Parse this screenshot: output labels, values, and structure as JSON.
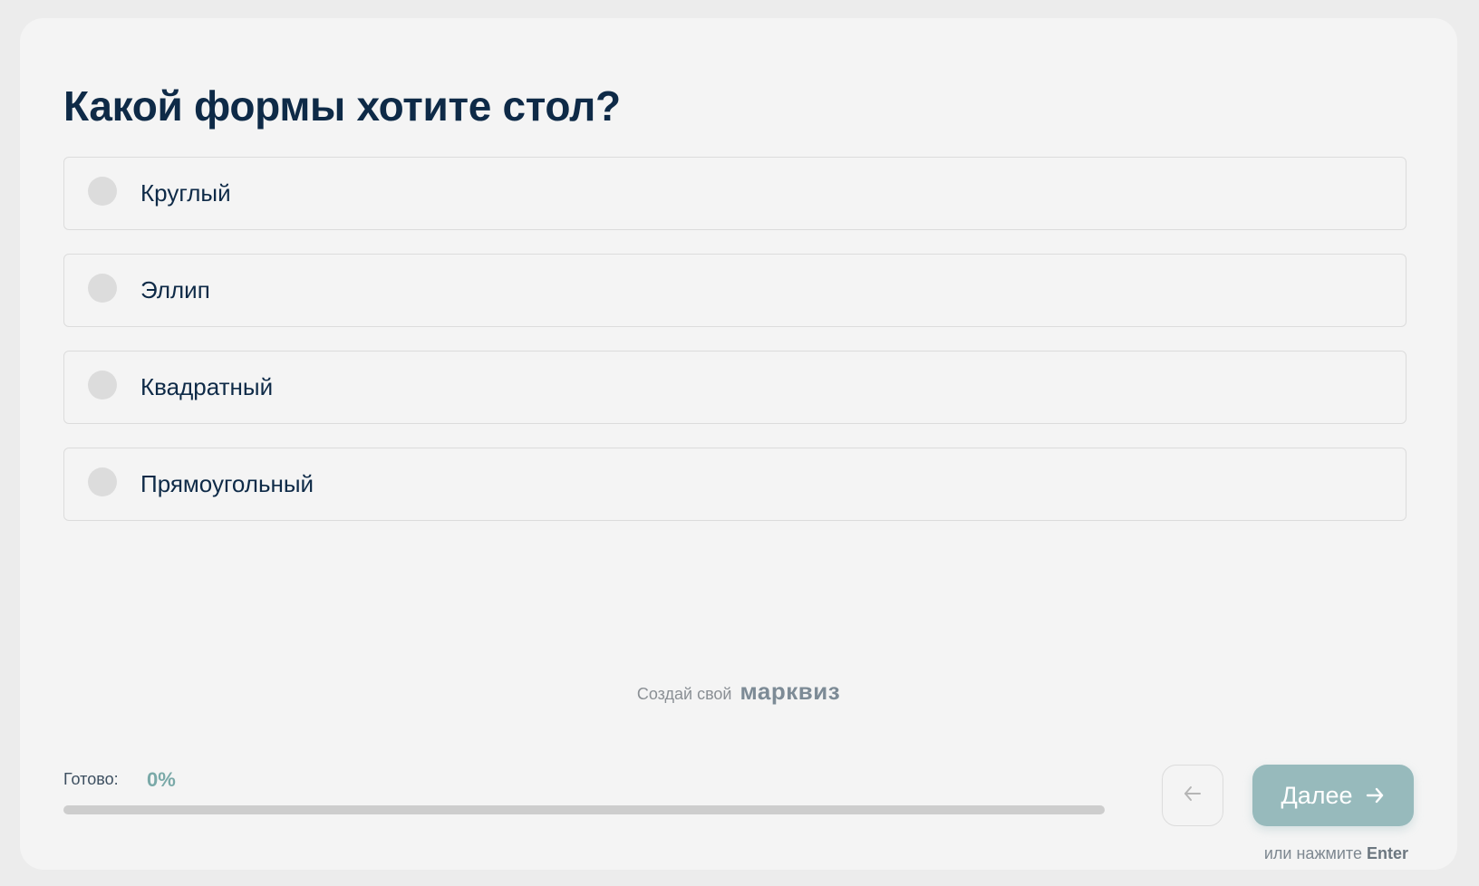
{
  "question": {
    "title": "Какой формы хотите стол?"
  },
  "options": [
    {
      "label": "Круглый"
    },
    {
      "label": "Эллип"
    },
    {
      "label": "Квадратный"
    },
    {
      "label": "Прямоугольный"
    }
  ],
  "promo": {
    "text": "Создай свой",
    "brand": "марквиз"
  },
  "progress": {
    "label": "Готово:",
    "value_text": "0%",
    "value": 0
  },
  "nav": {
    "back_icon": "arrow-left-icon",
    "next_label": "Далее",
    "next_icon": "arrow-right-icon",
    "hint_text": "или нажмите",
    "hint_key": "Enter"
  },
  "colors": {
    "accent": "#97babc",
    "progress_accent": "#7aa9a8",
    "title": "#0e2a47",
    "radio": "#dcdcdc"
  }
}
